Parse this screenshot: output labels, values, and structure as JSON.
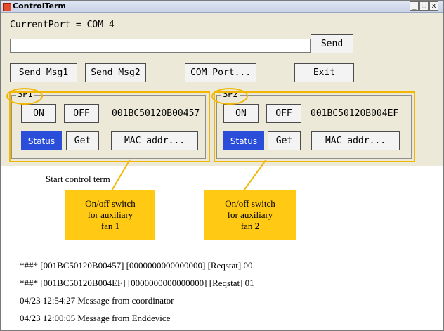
{
  "window": {
    "title": "ControlTerm",
    "controls": [
      "_",
      "□",
      "x"
    ]
  },
  "current_port_label": "CurrentPort = COM 4",
  "message_input": {
    "value": ""
  },
  "buttons": {
    "send": "Send",
    "send_msg1": "Send Msg1",
    "send_msg2": "Send Msg2",
    "com_port": "COM Port...",
    "exit": "Exit"
  },
  "sp1": {
    "label": "SP1",
    "on": "ON",
    "off": "OFF",
    "mac": "001BC50120B00457",
    "status": "Status",
    "get": "Get",
    "mac_addr": "MAC addr..."
  },
  "sp2": {
    "label": "SP2",
    "on": "ON",
    "off": "OFF",
    "mac": "001BC50120B004EF",
    "status": "Status",
    "get": "Get",
    "mac_addr": "MAC addr..."
  },
  "output": {
    "lines": [
      "Start control term",
      "*##* [001BC50120B00457] [0000000000000000] [Reqstat] 00",
      "*##* [001BC50120B004EF] [0000000000000000] [Reqstat] 01",
      "04/23 12:54:27 Message from coordinator",
      "04/23 12:00:05 Message from Enddevice"
    ]
  },
  "annotations": {
    "callout1": [
      "On/off switch",
      "for auxiliary",
      "fan 1"
    ],
    "callout2": [
      "On/off switch",
      "for auxiliary",
      "fan 2"
    ]
  },
  "colors": {
    "highlight": "#f2b705",
    "callout": "#ffc914",
    "status_blue": "#2a4ed9"
  }
}
